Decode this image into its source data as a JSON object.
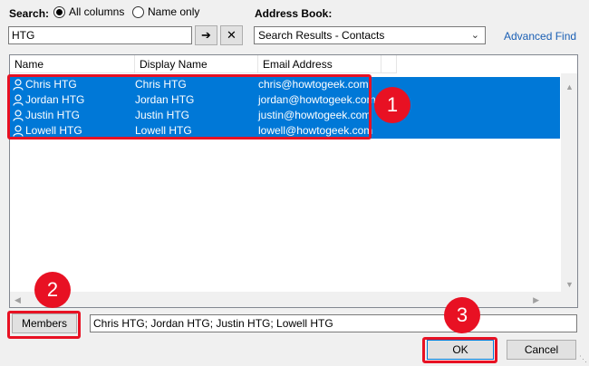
{
  "search": {
    "label": "Search:",
    "all_columns": "All columns",
    "name_only": "Name only",
    "query": "HTG",
    "go_glyph": "➔",
    "clear_glyph": "✕"
  },
  "address_book": {
    "label": "Address Book:",
    "selected": "Search Results - Contacts",
    "advanced_find": "Advanced Find"
  },
  "table": {
    "headers": [
      "Name",
      "Display Name",
      "Email Address"
    ],
    "rows": [
      {
        "name": "Chris HTG",
        "display": "Chris HTG",
        "email": "chris@howtogeek.com"
      },
      {
        "name": "Jordan HTG",
        "display": "Jordan HTG",
        "email": "jordan@howtogeek.com"
      },
      {
        "name": "Justin HTG",
        "display": "Justin HTG",
        "email": "justin@howtogeek.com"
      },
      {
        "name": "Lowell HTG",
        "display": "Lowell HTG",
        "email": "lowell@howtogeek.com"
      }
    ]
  },
  "members": {
    "button_label": "Members",
    "value": "Chris HTG; Jordan HTG; Justin HTG; Lowell HTG"
  },
  "buttons": {
    "ok": "OK",
    "cancel": "Cancel"
  },
  "annotations": {
    "badge1": "1",
    "badge2": "2",
    "badge3": "3"
  },
  "colors": {
    "selection": "#0078d7",
    "highlight": "#e81123",
    "link": "#1a5fb4"
  }
}
